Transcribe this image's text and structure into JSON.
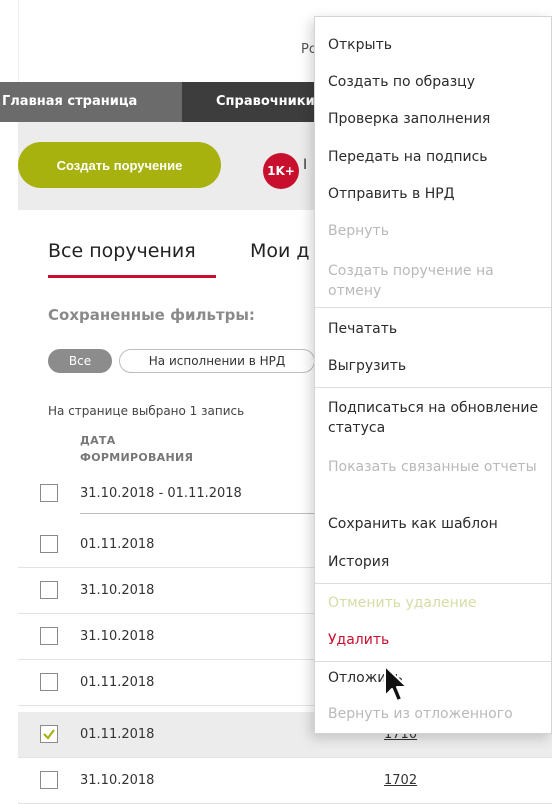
{
  "header": {
    "user_partial": "Ро"
  },
  "nav": {
    "items": [
      {
        "label": "Главная страница"
      },
      {
        "label": "Справочники"
      }
    ]
  },
  "toolbar": {
    "create_label": "Создать поручение",
    "badge_count": "1K+",
    "badge_label_partial": "I"
  },
  "tabs": [
    {
      "label": "Все поручения",
      "active": true
    },
    {
      "label": "Мои д"
    }
  ],
  "filters": {
    "label": "Сохраненные фильтры:",
    "chips": [
      {
        "label": "Все",
        "active": true
      },
      {
        "label": "На исполнении в НРД",
        "active": false
      }
    ]
  },
  "table": {
    "selected_info": "На странице выбрано 1 запись",
    "column_header": "ДАТА ФОРМИРОВАНИЯ",
    "filter_value": "31.10.2018 - 01.11.2018",
    "rows": [
      {
        "date": "01.11.2018",
        "num": "",
        "checked": false
      },
      {
        "date": "31.10.2018",
        "num": "",
        "checked": false
      },
      {
        "date": "31.10.2018",
        "num": "",
        "checked": false
      },
      {
        "date": "01.11.2018",
        "num": "",
        "checked": false
      },
      {
        "date": "01.11.2018",
        "num": "1710",
        "checked": true
      },
      {
        "date": "31.10.2018",
        "num": "1702",
        "checked": false
      }
    ]
  },
  "context_menu": {
    "items": [
      {
        "label": "Открыть",
        "state": "enabled"
      },
      {
        "label": "Создать по образцу",
        "state": "enabled"
      },
      {
        "label": "Проверка заполнения",
        "state": "enabled"
      },
      {
        "label": "Передать на подпись",
        "state": "enabled"
      },
      {
        "label": "Отправить в НРД",
        "state": "enabled"
      },
      {
        "label": "Вернуть",
        "state": "disabled"
      },
      {
        "label": "Создать поручение на отмену",
        "state": "disabled"
      },
      {
        "label": "Печатать",
        "state": "enabled"
      },
      {
        "label": "Выгрузить",
        "state": "enabled"
      },
      {
        "label": "Подписаться на обновление статуса",
        "state": "enabled"
      },
      {
        "label": "Показать связанные отчеты",
        "state": "disabled"
      },
      {
        "label": "Сохранить как шаблон",
        "state": "enabled"
      },
      {
        "label": "История",
        "state": "enabled"
      },
      {
        "label": "Отменить удаление",
        "state": "disabled"
      },
      {
        "label": "Удалить",
        "state": "danger"
      },
      {
        "label": "Отложить",
        "state": "enabled"
      },
      {
        "label": "Вернуть из отложенного",
        "state": "disabled"
      }
    ]
  },
  "colors": {
    "accent_red": "#c8102e",
    "create_button": "#a7b20f",
    "nav_bg": "#5f5f5f",
    "nav_active": "#3d3d3d"
  }
}
